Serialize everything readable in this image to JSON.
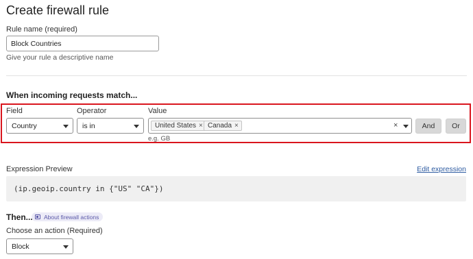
{
  "page": {
    "title": "Create firewall rule"
  },
  "rule_name": {
    "label": "Rule name (required)",
    "value": "Block Countries",
    "help": "Give your rule a descriptive name"
  },
  "match": {
    "title": "When incoming requests match...",
    "field": {
      "label": "Field",
      "value": "Country"
    },
    "operator": {
      "label": "Operator",
      "value": "is in"
    },
    "value": {
      "label": "Value",
      "tags": [
        "United States",
        "Canada"
      ],
      "clear_glyph": "×",
      "remove_glyph": "×",
      "help": "e.g. GB"
    },
    "and_label": "And",
    "or_label": "Or"
  },
  "expression": {
    "label": "Expression Preview",
    "edit_link": "Edit expression",
    "code": "(ip.geoip.country in {\"US\" \"CA\"})"
  },
  "action": {
    "title": "Then...",
    "about_badge": "About firewall actions",
    "label": "Choose an action (Required)",
    "value": "Block"
  },
  "colors": {
    "highlight_border": "#d9151d",
    "link": "#2c5aa0",
    "badge_bg": "#ecebf7",
    "badge_text": "#5a58a8"
  }
}
